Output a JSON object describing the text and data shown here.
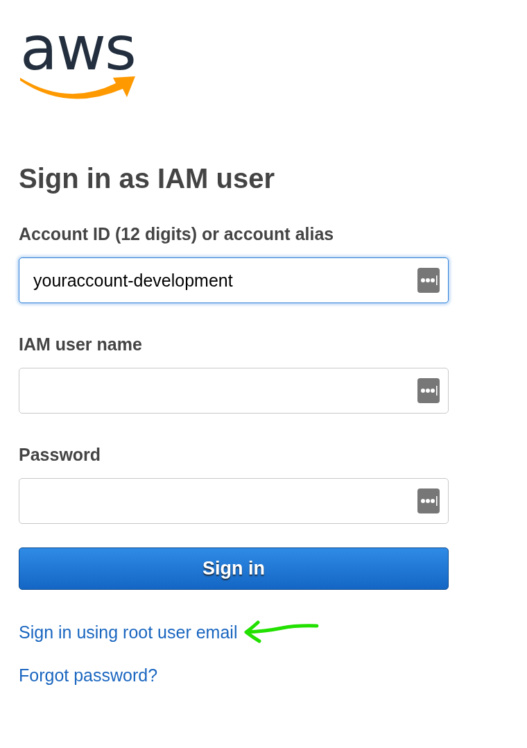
{
  "logo": {
    "text": "aws"
  },
  "heading": "Sign in as IAM user",
  "fields": [
    {
      "label": "Account ID (12 digits) or account alias",
      "value": "youraccount-development",
      "focused": true
    },
    {
      "label": "IAM user name",
      "focused": false
    },
    {
      "label": "Password",
      "focused": false
    }
  ],
  "sign_in_button": "Sign in",
  "links": [
    "Sign in using root user email",
    "Forgot password?"
  ]
}
